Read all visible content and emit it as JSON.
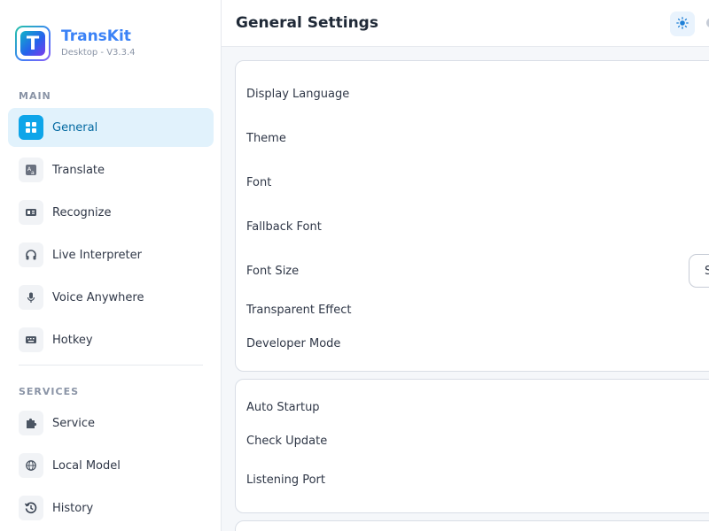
{
  "app": {
    "name": "TransKit",
    "version": "Desktop - V3.3.4",
    "logo_letter": "T"
  },
  "sidebar": {
    "main_label": "MAIN",
    "main_items": [
      {
        "label": "General",
        "icon": "grid-icon",
        "active": true
      },
      {
        "label": "Translate",
        "icon": "translate-icon"
      },
      {
        "label": "Recognize",
        "icon": "scan-icon"
      },
      {
        "label": "Live Interpreter",
        "icon": "headphones-icon"
      },
      {
        "label": "Voice Anywhere",
        "icon": "microphone-icon"
      },
      {
        "label": "Hotkey",
        "icon": "keyboard-icon"
      }
    ],
    "services_label": "SERVICES",
    "service_items": [
      {
        "label": "Service",
        "icon": "puzzle-icon"
      },
      {
        "label": "Local Model",
        "icon": "globe-icon"
      },
      {
        "label": "History",
        "icon": "history-icon"
      }
    ]
  },
  "header": {
    "title": "General Settings",
    "theme_light_icon": "sun-icon",
    "theme_dark_icon": "moon-icon"
  },
  "general_card": {
    "rows": [
      "Display Language",
      "Theme",
      "Font",
      "Fallback Font",
      "Font Size",
      "Transparent Effect",
      "Developer Mode"
    ],
    "font_size_value": "S"
  },
  "system_card": {
    "rows": [
      "Auto Startup",
      "Check Update",
      "Listening Port"
    ]
  },
  "colors": {
    "accent": "#0ea5e9",
    "brand": "#3b82f6",
    "active_bg": "#e1f2fc"
  }
}
